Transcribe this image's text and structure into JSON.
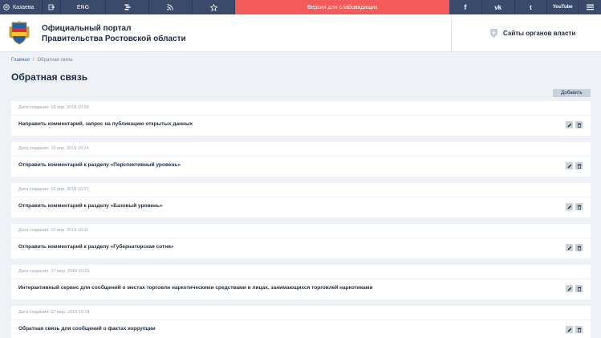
{
  "topbar": {
    "user_label": "Казаева",
    "lang_label": "ENG",
    "vision_label": "Версия для слабовидящих",
    "youtube_label": "YouTube"
  },
  "header": {
    "title_line1": "Официальный портал",
    "title_line2": "Правительства Ростовской области",
    "agencies_label": "Сайты органов власти"
  },
  "breadcrumbs": {
    "home": "Главная",
    "separator": "/",
    "current": "Обратная связь"
  },
  "page": {
    "title": "Обратная связь",
    "add_label": "Добавить"
  },
  "cards": [
    {
      "date": "Дата создания: 19 апр. 2019 15:28",
      "title": "Направить комментарий, запрос на публикацию открытых данных"
    },
    {
      "date": "Дата создания: 10 апр. 2019 15:24",
      "title": "Отправить комментарий к разделу «Перспективный уровень»"
    },
    {
      "date": "Дата создания: 10 апр. 2019 15:21",
      "title": "Отправить комментарий к разделу «Базовый уровень»"
    },
    {
      "date": "Дата создания: 10 апр. 2019 15:11",
      "title": "Отправить комментарий к разделу «Губернаторская сотня»"
    },
    {
      "date": "Дата создания: 27 мар. 2019 10:21",
      "title": "Интерактивный сервис для сообщений о местах торговли наркотическими средствами и лицах, занимающихся торговлей наркотиками"
    },
    {
      "date": "Дата создания: 27 мар. 2019 10:18",
      "title": "Обратная связь для сообщений о фактах коррупции"
    }
  ],
  "colors": {
    "topbar_bg": "#3a4a6b",
    "vision_bg": "#f35a5a",
    "page_bg": "#eef2f6",
    "text": "#1c2a44"
  }
}
